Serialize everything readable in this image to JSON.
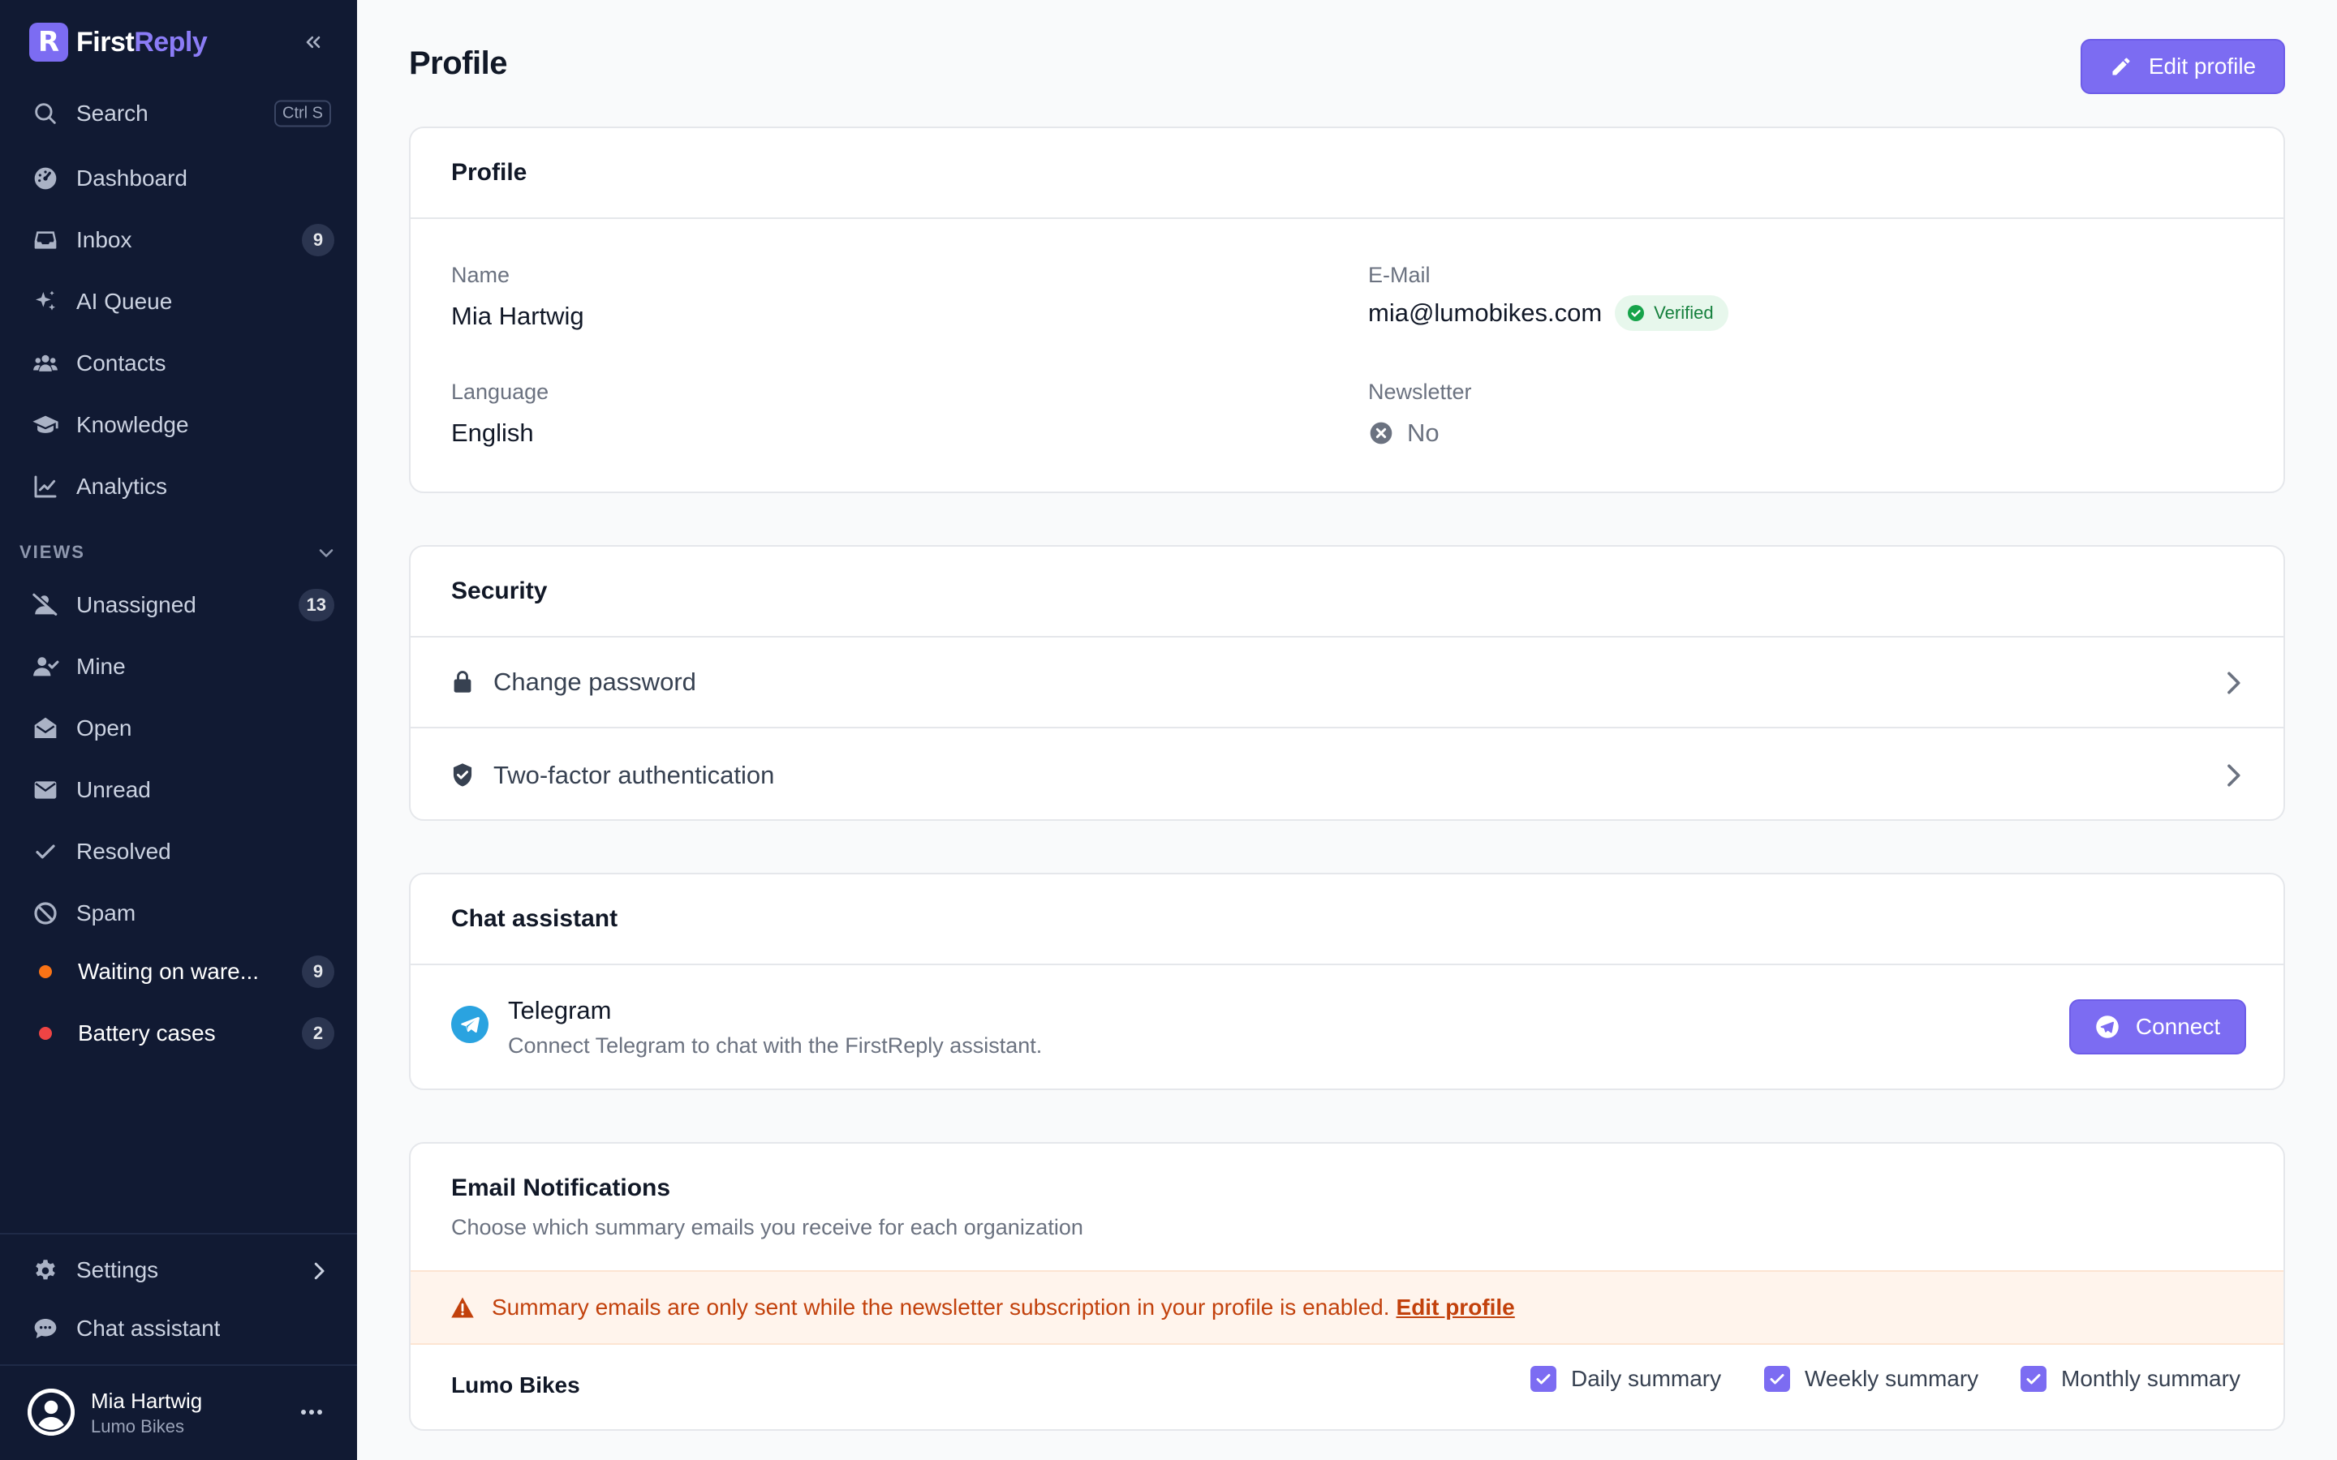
{
  "app": {
    "brand_first": "First",
    "brand_second": "Reply",
    "logo_letter": "R"
  },
  "sidebar": {
    "search_label": "Search",
    "search_shortcut": "Ctrl S",
    "items": [
      {
        "label": "Dashboard",
        "icon": "dashboard-icon"
      },
      {
        "label": "Inbox",
        "icon": "inbox-icon",
        "badge": "9"
      },
      {
        "label": "AI Queue",
        "icon": "sparkles-icon"
      },
      {
        "label": "Contacts",
        "icon": "users-icon"
      },
      {
        "label": "Knowledge",
        "icon": "graduation-cap-icon"
      },
      {
        "label": "Analytics",
        "icon": "chart-line-icon"
      }
    ],
    "views_label": "VIEWS",
    "views": [
      {
        "label": "Unassigned",
        "icon": "user-slash-icon",
        "badge": "13"
      },
      {
        "label": "Mine",
        "icon": "user-check-icon"
      },
      {
        "label": "Open",
        "icon": "envelope-open-icon"
      },
      {
        "label": "Unread",
        "icon": "envelope-icon"
      },
      {
        "label": "Resolved",
        "icon": "check-icon"
      },
      {
        "label": "Spam",
        "icon": "ban-icon"
      },
      {
        "label": "Waiting on ware...",
        "dot_color": "#f97316",
        "badge": "9"
      },
      {
        "label": "Battery cases",
        "dot_color": "#ef4444",
        "badge": "2"
      }
    ],
    "settings_label": "Settings",
    "chat_assistant_label": "Chat assistant",
    "user": {
      "name": "Mia Hartwig",
      "org": "Lumo Bikes"
    }
  },
  "main": {
    "title": "Profile",
    "edit_profile_label": "Edit profile",
    "profile_card": {
      "title": "Profile",
      "name_label": "Name",
      "name_value": "Mia Hartwig",
      "email_label": "E-Mail",
      "email_value": "mia@lumobikes.com",
      "verified_label": "Verified",
      "language_label": "Language",
      "language_value": "English",
      "newsletter_label": "Newsletter",
      "newsletter_value": "No"
    },
    "security_card": {
      "title": "Security",
      "change_password_label": "Change password",
      "two_factor_label": "Two-factor authentication"
    },
    "chat_card": {
      "title": "Chat assistant",
      "telegram_title": "Telegram",
      "telegram_desc": "Connect Telegram to chat with the FirstReply assistant.",
      "connect_label": "Connect"
    },
    "notifications_card": {
      "title": "Email Notifications",
      "subtitle": "Choose which summary emails you receive for each organization",
      "alert_text": "Summary emails are only sent while the newsletter subscription in your profile is enabled.",
      "alert_link": "Edit profile",
      "org_name": "Lumo Bikes",
      "daily_label": "Daily summary",
      "weekly_label": "Weekly summary",
      "monthly_label": "Monthly summary"
    }
  },
  "colors": {
    "sidebar_bg": "#111a33",
    "accent": "#7c6cf2",
    "verified_green": "#15803d",
    "alert_orange": "#c2410c"
  }
}
